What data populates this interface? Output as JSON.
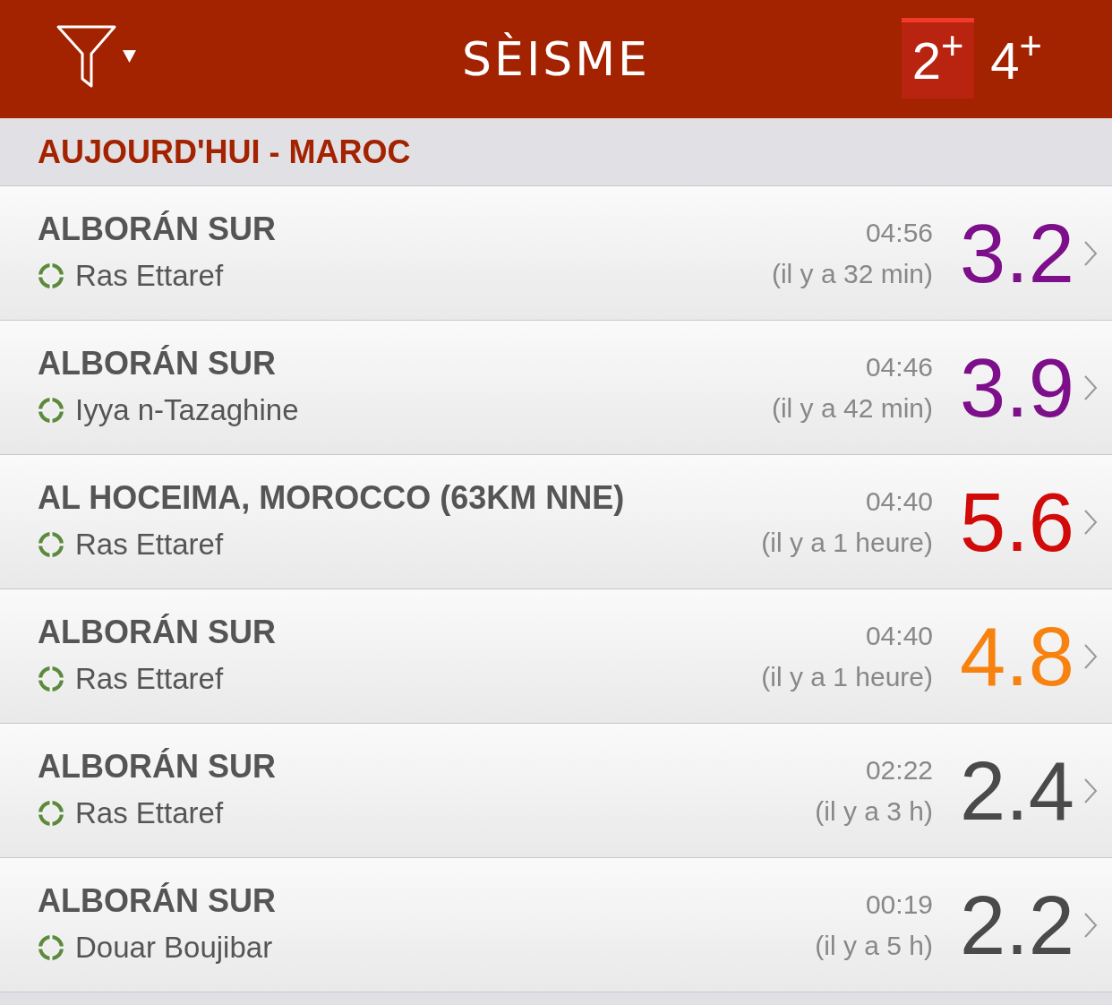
{
  "header": {
    "title": "SÈISME",
    "filters": [
      {
        "label": "2$^{+}$",
        "selected": true
      },
      {
        "label": "4$^{+}$",
        "selected": false
      }
    ]
  },
  "section": {
    "title": "AUJOURD'HUI - MAROC"
  },
  "quakes": [
    {
      "region": "ALBORÁN SUR",
      "place": "Ras Ettaref",
      "time": "04:56",
      "ago": "(il y a 32 min)",
      "magnitude": "3.2",
      "color": "#7d0f8a"
    },
    {
      "region": "ALBORÁN SUR",
      "place": "Iyya n-Tazaghine",
      "time": "04:46",
      "ago": "(il y a 42 min)",
      "magnitude": "3.9",
      "color": "#7d0f8a"
    },
    {
      "region": "AL HOCEIMA, MOROCCO (63KM NNE)",
      "place": "Ras Ettaref",
      "time": "04:40",
      "ago": "(il y a 1 heure)",
      "magnitude": "5.6",
      "color": "#d10a0a"
    },
    {
      "region": "ALBORÁN SUR",
      "place": "Ras Ettaref",
      "time": "04:40",
      "ago": "(il y a 1 heure)",
      "magnitude": "4.8",
      "color": "#f7820f"
    },
    {
      "region": "ALBORÁN SUR",
      "place": "Ras Ettaref",
      "time": "02:22",
      "ago": "(il y a 3 h)",
      "magnitude": "2.4",
      "color": "#4a4a4a"
    },
    {
      "region": "ALBORÁN SUR",
      "place": "Douar Boujibar",
      "time": "00:19",
      "ago": "(il y a 5 h)",
      "magnitude": "2.2",
      "color": "#4a4a4a"
    }
  ]
}
